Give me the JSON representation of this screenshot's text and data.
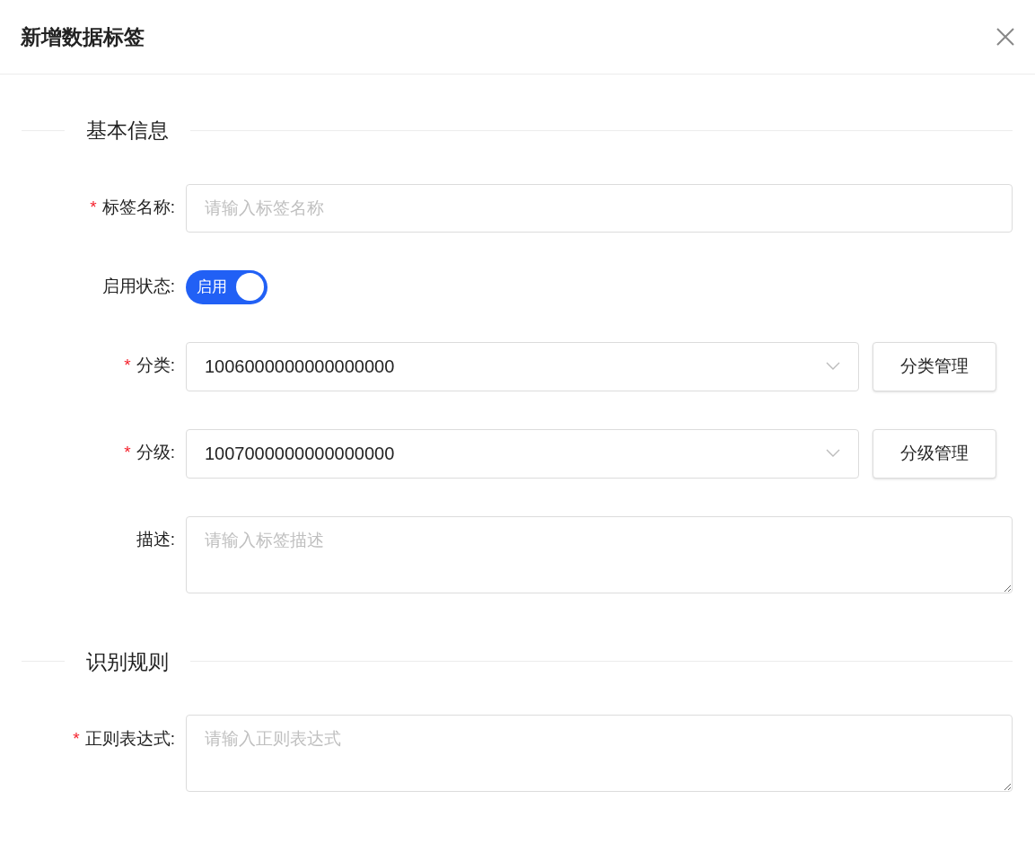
{
  "title": "新增数据标签",
  "sections": [
    {
      "title": "基本信息",
      "fields": [
        {
          "kind": "input",
          "asterisk": "*",
          "label": "标签名称:",
          "placeholder": "请输入标签名称"
        },
        {
          "kind": "switch",
          "label": "启用状态:",
          "on": true,
          "text": "启用"
        },
        {
          "kind": "select",
          "asterisk": "*",
          "label": "分类:",
          "value": "1006000000000000000",
          "button": "分类管理"
        },
        {
          "kind": "select",
          "asterisk": "*",
          "label": "分级:",
          "value": "1007000000000000000",
          "button": "分级管理"
        },
        {
          "kind": "textarea",
          "label": "描述:",
          "placeholder": "请输入标签描述"
        }
      ]
    },
    {
      "title": "识别规则",
      "fields": [
        {
          "kind": "textarea",
          "asterisk": "*",
          "label": "正则表达式:",
          "placeholder": "请输入正则表达式"
        }
      ]
    }
  ]
}
